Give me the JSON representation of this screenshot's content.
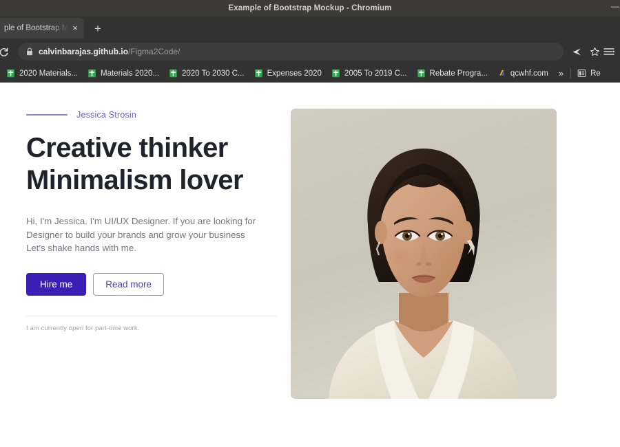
{
  "window": {
    "title": "Example of Bootstrap Mockup - Chromium",
    "minimize_label": "—"
  },
  "browser": {
    "tab": {
      "title": "ple of Bootstrap Mo",
      "close_label": "×"
    },
    "new_tab_label": "+",
    "reload_icon": "reload-icon",
    "omnibox": {
      "lock_icon": "lock-icon",
      "url_domain": "calvinbarajas.github.io",
      "url_path": "/Figma2Code/"
    },
    "actions": [
      {
        "name": "share-icon",
        "label": "➤"
      },
      {
        "name": "bookmark-star-icon",
        "label": "☆"
      },
      {
        "name": "chrome-menu-icon",
        "label": "≡"
      }
    ],
    "bookmarks": [
      {
        "label": "2020 Materials...",
        "icon": "sheets-icon"
      },
      {
        "label": "Materials 2020...",
        "icon": "sheets-icon"
      },
      {
        "label": "2020 To 2030 C...",
        "icon": "sheets-icon"
      },
      {
        "label": "Expenses 2020",
        "icon": "sheets-icon"
      },
      {
        "label": "2005 To 2019 C...",
        "icon": "sheets-icon"
      },
      {
        "label": "Rebate Progra...",
        "icon": "sheets-icon"
      },
      {
        "label": "qcwhf.com",
        "icon": "generic-site-icon"
      }
    ],
    "bookmarks_overflow_label": "»",
    "reading_list_label": "Re"
  },
  "page": {
    "eyebrow_name": "Jessica Strosin",
    "headline_line1": "Creative thinker",
    "headline_line2": "Minimalism lover",
    "lead": "Hi, I'm Jessica. I'm UI/UX Designer. If you are looking for Designer to build your brands and grow your business Let's shake hands with me.",
    "primary_button": "Hire me",
    "secondary_button": "Read more",
    "note": "I am currently open for part-time work.",
    "photo_alt": "portrait-photo-of-woman",
    "colors": {
      "accent": "#3b1fb5",
      "eyebrow": "#6b62c9",
      "headline": "#22222a",
      "body_text": "#767680",
      "photo_background": "#c9c6ba"
    }
  }
}
